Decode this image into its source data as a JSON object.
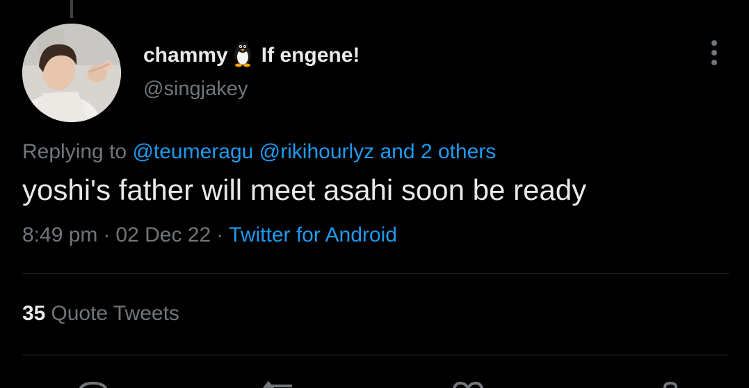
{
  "tweet": {
    "display_name": "chammy",
    "display_name_emoji": "penguin-icon",
    "display_name_suffix": "If engene!",
    "handle": "@singjakey",
    "replying_prefix": "Replying to",
    "reply_mention_1": "@teumeragu",
    "reply_mention_2": "@rikihourlyz",
    "reply_others": "and 2 others",
    "text": "yoshi's father will meet asahi soon be ready",
    "time": "8:49 pm",
    "date": "02 Dec 22",
    "separator": "·",
    "source": "Twitter for Android"
  },
  "stats": {
    "quote_count": "35",
    "quote_label": "Quote Tweets"
  },
  "actions": [
    "reply-icon",
    "retweet-icon",
    "like-icon",
    "share-icon"
  ],
  "colors": {
    "background": "#000000",
    "primary_text": "#e7e9ea",
    "secondary_text": "#71767b",
    "link": "#1d9bf0",
    "divider": "#2f3336"
  }
}
